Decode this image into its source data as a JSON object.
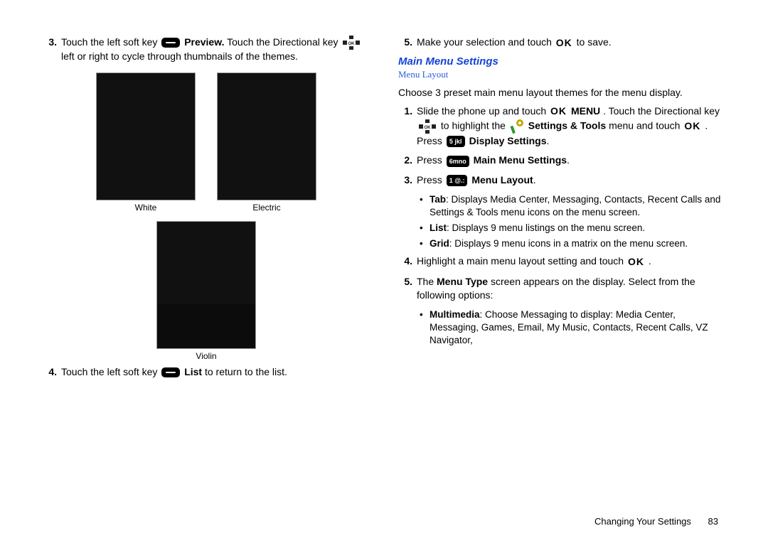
{
  "left": {
    "step3_a": "Touch the left soft key ",
    "step3_b": " Preview.",
    "step3_c": " Touch the Directional key ",
    "step3_d": " left or right to cycle through thumbnails of the themes.",
    "thumb1": "White",
    "thumb2": "Electric",
    "thumb3": "Violin",
    "step4_a": "Touch the left soft key ",
    "step4_b": " List",
    "step4_c": " to return to the list."
  },
  "right": {
    "step5top_a": "Make your selection and touch ",
    "step5top_b": " to save.",
    "h1": "Main Menu Settings",
    "h2": "Menu Layout",
    "intro": "Choose 3 preset main menu layout themes for the menu display.",
    "s1_a": "Slide the phone up and touch ",
    "s1_b": " MENU",
    "s1_c": ". Touch the Directional key ",
    "s1_d": " to highlight the ",
    "s1_e": "Settings & Tools",
    "s1_f": " menu and touch ",
    "s1_g": ". Press ",
    "s1_h": "Display Settings",
    "s1_i": ".",
    "key5": "5 jkl",
    "s2_a": "Press ",
    "s2_b": " Main Menu Settings",
    "s2_c": ".",
    "key6": "6mno",
    "s3_a": "Press ",
    "s3_b": " Menu Layout",
    "s3_c": ".",
    "key1": "1 @.:",
    "b1_a": "Tab",
    "b1_b": ": Displays Media Center, Messaging, Contacts, Recent Calls and Settings & Tools menu icons on the menu screen.",
    "b2_a": "List",
    "b2_b": ": Displays 9 menu listings on the menu screen.",
    "b3_a": "Grid",
    "b3_b": ": Displays 9 menu icons in a matrix on the menu screen.",
    "s4_a": "Highlight a main menu layout setting and touch ",
    "s4_b": ".",
    "s5_a": "The ",
    "s5_b": "Menu Type",
    "s5_c": " screen appears on the display. Select from the following options:",
    "b4_a": "Multimedia",
    "b4_b": ": Choose Messaging to display: Media Center, Messaging, Games, Email, My Music, Contacts, Recent Calls, VZ Navigator,"
  },
  "footer": {
    "section": "Changing Your Settings",
    "page": "83"
  }
}
